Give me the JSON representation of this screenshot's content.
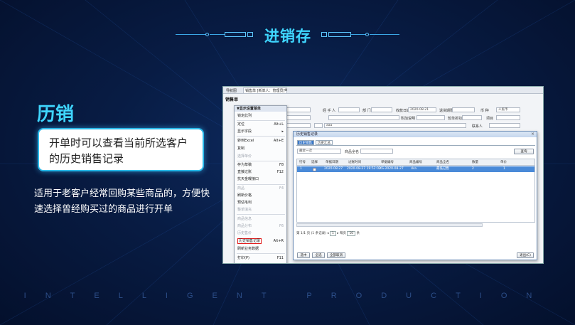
{
  "header": {
    "title": "进销存"
  },
  "main": {
    "title": "历销",
    "box_text": "开单时可以查看当前所选客户的历史销售记录",
    "body_text": "适用于老客户经常回购某些商品的，方便快速选择曾经购买过的商品进行开单"
  },
  "footer": {
    "text": "INTELLIGENT PRODUCTION"
  },
  "screenshot": {
    "tabs": [
      "导航图",
      "销售单 [新单人：管理员]"
    ],
    "doc_title": "销售单",
    "form": {
      "handler_label": "经 手 人",
      "dept_label": "部 门",
      "date_label": "收款日期",
      "date_value": "2020-08-21",
      "deadline_label": "退货期限",
      "currency_label": "币 种",
      "currency_value": "人民币",
      "extra_label": "附加说明",
      "settle_label": "暂单折扣",
      "project_label": "项目",
      "customer_value": "aaa",
      "contact_label": "联系人",
      "contact_phone_label": "联系人电话"
    },
    "context_menu": [
      {
        "label": "▼显示设置菜单",
        "shortcut": "",
        "state": "head"
      },
      {
        "label": "锁定此列",
        "shortcut": "",
        "state": "normal"
      },
      {
        "label": "定位",
        "shortcut": "Alt+L",
        "state": "normal"
      },
      {
        "label": "显示字段",
        "shortcut": "▸",
        "state": "normal"
      },
      {
        "label": "转到Excel",
        "shortcut": "Alt+E",
        "state": "normal"
      },
      {
        "label": "复制",
        "shortcut": "",
        "state": "normal"
      },
      {
        "label": "选择单价",
        "shortcut": "",
        "state": "disabled"
      },
      {
        "label": "存为草稿",
        "shortcut": "F8",
        "state": "normal"
      },
      {
        "label": "直接过账",
        "shortcut": "F12",
        "state": "normal"
      },
      {
        "label": "抗天金曝接口",
        "shortcut": "",
        "state": "normal"
      },
      {
        "label": "商品",
        "shortcut": "F4",
        "state": "disabled"
      },
      {
        "label": "刷新价格",
        "shortcut": "",
        "state": "normal"
      },
      {
        "label": "预估毛利",
        "shortcut": "",
        "state": "normal"
      },
      {
        "label": "整单填充",
        "shortcut": "",
        "state": "disabled"
      },
      {
        "label": "商品信息",
        "shortcut": "",
        "state": "disabled"
      },
      {
        "label": "商品分布",
        "shortcut": "F6",
        "state": "disabled"
      },
      {
        "label": "历史售价",
        "shortcut": "",
        "state": "disabled"
      },
      {
        "label": "历史销售记录",
        "shortcut": "Alt+R",
        "state": "highlight"
      },
      {
        "label": "刷新业务数据",
        "shortcut": "",
        "state": "normal"
      },
      {
        "label": "打印(P)",
        "shortcut": "F11",
        "state": "normal"
      }
    ],
    "dialog": {
      "title": "历史销售记录",
      "tabs": [
        "历史销售",
        "历史汇总"
      ],
      "filter_value": "最近一次",
      "product_label": "商品全名",
      "query_button": "查询",
      "columns": [
        "行号",
        "选择",
        "单据日期",
        "过账时间",
        "单据编号",
        "商品编号",
        "商品全名",
        "数量",
        "单价"
      ],
      "row": [
        "1",
        "",
        "2020-08-27",
        "2020-08-27 19:52:02",
        "XS-2020-08-27",
        "dsa",
        "最低已售",
        "2",
        "1"
      ],
      "pager": "第 1/1 页 (1 条记录)",
      "page_num": "1",
      "per_page_label": "每页",
      "per_page_value": "10",
      "per_page_unit": "条",
      "buttons": [
        "选中",
        "全选",
        "全部取消"
      ],
      "exit_button": "退出(C)"
    }
  }
}
